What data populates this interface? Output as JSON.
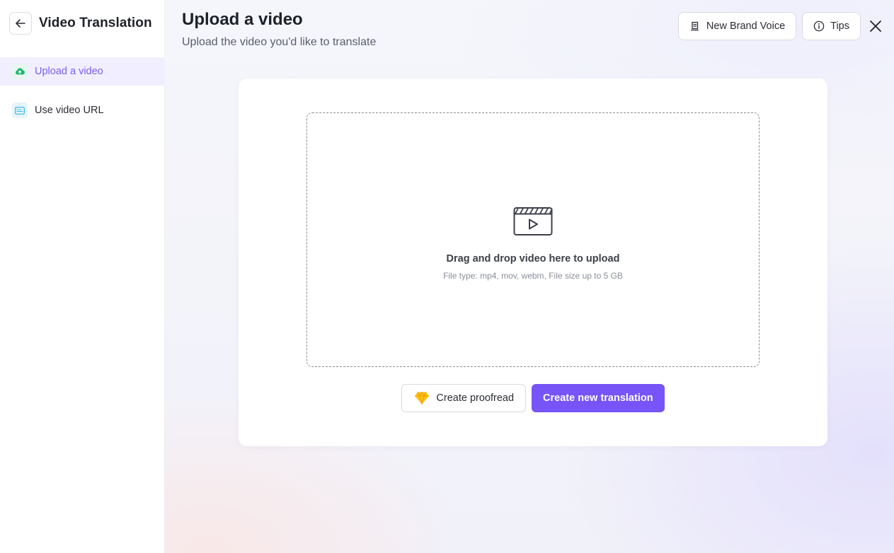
{
  "sidebar": {
    "title": "Video Translation",
    "back_icon": "arrow-left-icon",
    "items": [
      {
        "label": "Upload a video",
        "icon": "cloud-upload-icon",
        "active": true
      },
      {
        "label": "Use video URL",
        "icon": "url-icon",
        "active": false
      }
    ]
  },
  "header": {
    "title": "Upload a video",
    "subtitle": "Upload the video you'd like to translate",
    "brand_voice_label": "New Brand Voice",
    "tips_label": "Tips"
  },
  "dropzone": {
    "title": "Drag and drop video here to upload",
    "hint": "File type: mp4, mov, webm, File size up to 5 GB"
  },
  "actions": {
    "proofread_label": "Create proofread",
    "translation_label": "Create new translation"
  },
  "colors": {
    "accent": "#7654f7",
    "active_text": "#7b5cf0",
    "active_bg": "#f1efff"
  }
}
